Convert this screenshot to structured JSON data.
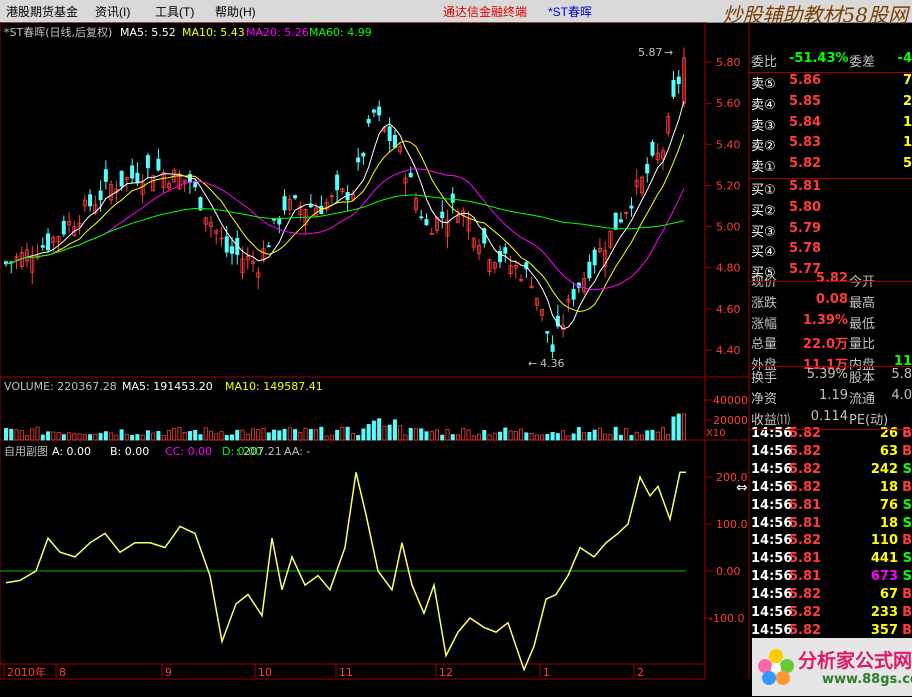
{
  "menu": {
    "items": [
      "港股期货基金",
      "资讯(I)",
      "工具(T)",
      "帮助(H)"
    ],
    "brand": "通达信金融终端",
    "stock": "*ST春晖",
    "logo": "炒股辅助教材58股网",
    "logo_url": "www.58Gu.com"
  },
  "main": {
    "title": "*ST春晖(日线,后复权)",
    "ma5": "MA5: 5.52",
    "ma10": "MA10: 5.43",
    "ma20": "MA20: 5.26",
    "ma60": "MA60: 4.99",
    "high_label": "5.87",
    "low_label": "4.36",
    "y_ticks": [
      "5.80",
      "5.60",
      "5.40",
      "5.20",
      "5.00",
      "4.80",
      "4.60",
      "4.40"
    ]
  },
  "volume": {
    "label": "VOLUME: 220367.28",
    "ma5": "MA5: 191453.20",
    "ma10": "MA10: 149587.41",
    "y_ticks": [
      "40000",
      "20000"
    ],
    "unit": "X10"
  },
  "indicator": {
    "label": "自用副图",
    "a": "A: 0.00",
    "b": "B: 0.00",
    "cc": "CC: 0.00",
    "d": "D: 0.00",
    "val": ": 207.21",
    "aa": "AA: -",
    "y_ticks": [
      "200.0",
      "100.0",
      "0.00",
      "-100.0"
    ]
  },
  "xaxis": {
    "labels": [
      "2010年",
      "8",
      "9",
      "10",
      "11",
      "12",
      "1",
      "2"
    ]
  },
  "quote": {
    "header": {
      "weibi_label": "委比",
      "weibi_value": "-51.43%",
      "weicha_label": "委差",
      "weicha_value": "-4"
    },
    "sells": [
      {
        "label": "卖⑤",
        "price": "5.86",
        "vol": "7"
      },
      {
        "label": "卖④",
        "price": "5.85",
        "vol": "2"
      },
      {
        "label": "卖③",
        "price": "5.84",
        "vol": "1"
      },
      {
        "label": "卖②",
        "price": "5.83",
        "vol": "1"
      },
      {
        "label": "卖①",
        "price": "5.82",
        "vol": "5"
      }
    ],
    "buys": [
      {
        "label": "买①",
        "price": "5.81",
        "vol": ""
      },
      {
        "label": "买②",
        "price": "5.80",
        "vol": ""
      },
      {
        "label": "买③",
        "price": "5.79",
        "vol": ""
      },
      {
        "label": "买④",
        "price": "5.78",
        "vol": ""
      },
      {
        "label": "买⑤",
        "price": "5.77",
        "vol": ""
      }
    ],
    "stats": [
      {
        "l1": "现价",
        "v1": "5.82",
        "l2": "今开",
        "v2": ""
      },
      {
        "l1": "涨跌",
        "v1": "0.08",
        "l2": "最高",
        "v2": ""
      },
      {
        "l1": "涨幅",
        "v1": "1.39%",
        "l2": "最低",
        "v2": ""
      },
      {
        "l1": "总量",
        "v1": "22.0万",
        "l2": "量比",
        "v2": ""
      },
      {
        "l1": "外盘",
        "v1": "11.1万",
        "l2": "内盘",
        "v2": "11"
      }
    ],
    "stats2": [
      {
        "l1": "换手",
        "v1": "5.39%",
        "l2": "股本",
        "v2": "5.8"
      },
      {
        "l1": "净资",
        "v1": "1.19",
        "l2": "流通",
        "v2": "4.0"
      },
      {
        "l1": "收益⑾",
        "v1": "0.114",
        "l2": "PE(动)",
        "v2": ""
      }
    ],
    "ticks": [
      {
        "t": "14:56",
        "p": "5.82",
        "v": "26",
        "s": "B"
      },
      {
        "t": "14:56",
        "p": "5.82",
        "v": "63",
        "s": "B"
      },
      {
        "t": "14:56",
        "p": "5.82",
        "v": "242",
        "s": "S"
      },
      {
        "t": "14:56",
        "p": "5.82",
        "v": "18",
        "s": "B"
      },
      {
        "t": "14:56",
        "p": "5.81",
        "v": "76",
        "s": "S"
      },
      {
        "t": "14:56",
        "p": "5.81",
        "v": "18",
        "s": "S"
      },
      {
        "t": "14:56",
        "p": "5.82",
        "v": "110",
        "s": "B"
      },
      {
        "t": "14:56",
        "p": "5.81",
        "v": "441",
        "s": "S"
      },
      {
        "t": "14:56",
        "p": "5.81",
        "v": "673",
        "s": "S"
      },
      {
        "t": "14:56",
        "p": "5.82",
        "v": "67",
        "s": "B"
      },
      {
        "t": "14:56",
        "p": "5.82",
        "v": "233",
        "s": "B"
      },
      {
        "t": "14:56",
        "p": "5.82",
        "v": "357",
        "s": "B"
      }
    ]
  },
  "watermark": {
    "name": "分析家公式网",
    "url": "www.88gs.com"
  },
  "colors": {
    "up": "#ff3c3c",
    "down": "#54ffff",
    "ma5": "#ffffff",
    "ma10": "#ffff00",
    "ma20": "#ff00ff",
    "ma60": "#00ff00",
    "axis": "#a00000",
    "price": "#ff3c3c",
    "volume": "#ffff00"
  }
}
